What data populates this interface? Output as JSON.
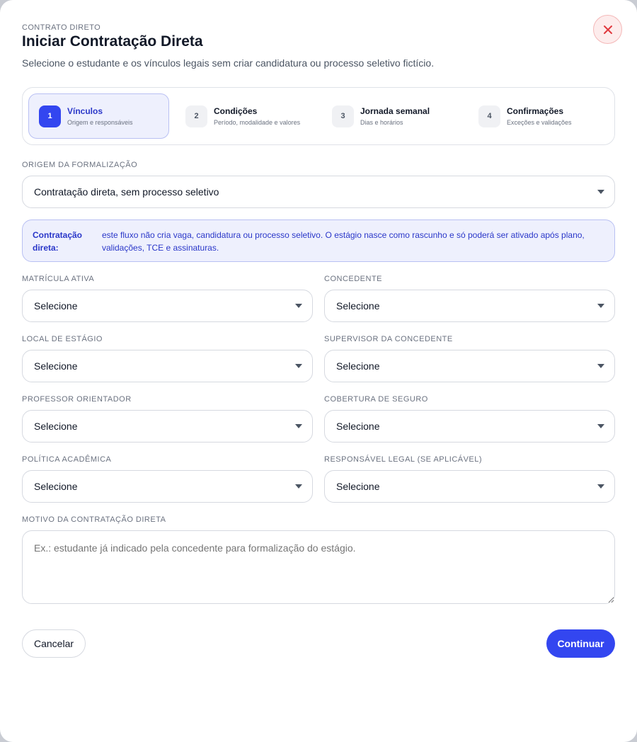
{
  "header": {
    "eyebrow": "CONTRATO DIRETO",
    "title": "Iniciar Contratação Direta",
    "subtitle": "Selecione o estudante e os vínculos legais sem criar candidatura ou processo seletivo fictício."
  },
  "steps": [
    {
      "num": "1",
      "title": "Vínculos",
      "desc": "Origem e responsáveis",
      "active": true
    },
    {
      "num": "2",
      "title": "Condições",
      "desc": "Período, modalidade e valores",
      "active": false
    },
    {
      "num": "3",
      "title": "Jornada semanal",
      "desc": "Dias e horários",
      "active": false
    },
    {
      "num": "4",
      "title": "Confirmações",
      "desc": "Exceções e validações",
      "active": false
    }
  ],
  "origin": {
    "label": "ORIGEM DA FORMALIZAÇÃO",
    "value": "Contratação direta, sem processo seletivo"
  },
  "notice": {
    "label": "Contratação direta:",
    "text": "este fluxo não cria vaga, candidatura ou processo seletivo. O estágio nasce como rascunho e só poderá ser ativado após plano, validações, TCE e assinaturas."
  },
  "fields": {
    "matricula": {
      "label": "MATRÍCULA ATIVA",
      "value": "Selecione"
    },
    "concedente": {
      "label": "CONCEDENTE",
      "value": "Selecione"
    },
    "local": {
      "label": "LOCAL DE ESTÁGIO",
      "value": "Selecione"
    },
    "supervisor": {
      "label": "SUPERVISOR DA CONCEDENTE",
      "value": "Selecione"
    },
    "professor": {
      "label": "PROFESSOR ORIENTADOR",
      "value": "Selecione"
    },
    "seguro": {
      "label": "COBERTURA DE SEGURO",
      "value": "Selecione"
    },
    "politica": {
      "label": "POLÍTICA ACADÊMICA",
      "value": "Selecione"
    },
    "responsavel": {
      "label": "RESPONSÁVEL LEGAL (SE APLICÁVEL)",
      "value": "Selecione"
    }
  },
  "motivo": {
    "label": "MOTIVO DA CONTRATAÇÃO DIRETA",
    "placeholder": "Ex.: estudante já indicado pela concedente para formalização do estágio."
  },
  "footer": {
    "cancel_label": "Cancelar",
    "continue_label": "Continuar"
  },
  "colors": {
    "accent": "#3346f0",
    "close": "#e0393e"
  }
}
